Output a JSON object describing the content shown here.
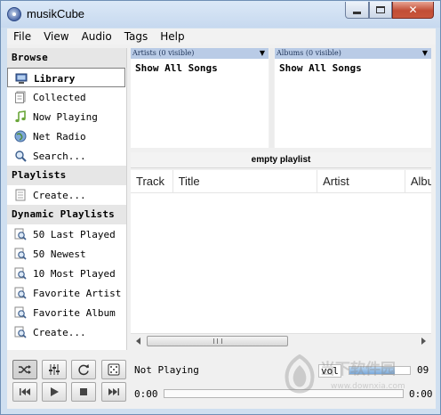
{
  "window": {
    "title": "musikCube"
  },
  "menu": [
    "File",
    "View",
    "Audio",
    "Tags",
    "Help"
  ],
  "sidebar": {
    "sections": [
      {
        "header": "Browse",
        "items": [
          {
            "label": "Library",
            "icon": "library-icon",
            "selected": true
          },
          {
            "label": "Collected",
            "icon": "collected-icon"
          },
          {
            "label": "Now Playing",
            "icon": "music-note-icon"
          },
          {
            "label": "Net Radio",
            "icon": "globe-icon"
          },
          {
            "label": "Search...",
            "icon": "search-icon"
          }
        ]
      },
      {
        "header": "Playlists",
        "items": [
          {
            "label": "Create...",
            "icon": "document-icon"
          }
        ]
      },
      {
        "header": "Dynamic Playlists",
        "items": [
          {
            "label": "50 Last Played",
            "icon": "dynamic-playlist-icon"
          },
          {
            "label": "50 Newest",
            "icon": "dynamic-playlist-icon"
          },
          {
            "label": "10 Most Played",
            "icon": "dynamic-playlist-icon"
          },
          {
            "label": "Favorite Artist",
            "icon": "dynamic-playlist-icon"
          },
          {
            "label": "Favorite Album",
            "icon": "dynamic-playlist-icon"
          },
          {
            "label": "Create...",
            "icon": "dynamic-playlist-icon"
          }
        ]
      }
    ]
  },
  "browse": {
    "artists": {
      "header": "Artists (0 visible)",
      "item": "Show All Songs"
    },
    "albums": {
      "header": "Albums (0 visible)",
      "item": "Show All Songs"
    }
  },
  "playlist": {
    "title": "empty playlist",
    "columns": [
      "Track",
      "Title",
      "Artist",
      "Album"
    ]
  },
  "transport": {
    "status": "Not Playing",
    "vol_label": "vol",
    "vol_value": "09",
    "volume_fraction": 0.75,
    "time_elapsed": "0:00",
    "time_total": "0:00"
  },
  "watermark": {
    "text": "当下软件园",
    "url": "www.downxia.com"
  },
  "colors": {
    "titlebar": "#c7d9ef",
    "pane_header": "#b9cbe6",
    "close_button": "#c24d35"
  }
}
